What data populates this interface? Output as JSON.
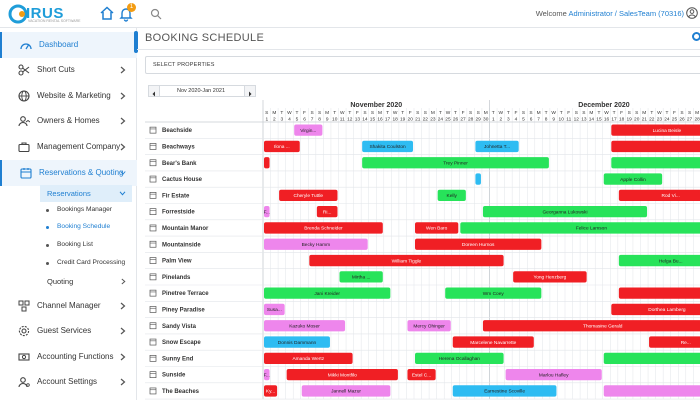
{
  "header": {
    "logo_text": "IRUS",
    "logo_tagline": "VACATION RENTAL SOFTWARE",
    "notification_count": "1",
    "welcome_prefix": "Welcome",
    "welcome_user": "Administrator / SalesTeam (70316)"
  },
  "sidebar": {
    "items": [
      {
        "label": "Dashboard",
        "icon": "dashboard-icon"
      },
      {
        "label": "Short Cuts",
        "icon": "scissors-icon"
      },
      {
        "label": "Website & Marketing",
        "icon": "globe-icon"
      },
      {
        "label": "Owners & Homes",
        "icon": "user-home-icon"
      },
      {
        "label": "Management Company",
        "icon": "briefcase-icon"
      },
      {
        "label": "Reservations & Quoting",
        "icon": "calendar-icon"
      },
      {
        "label": "Channel Manager",
        "icon": "channel-icon"
      },
      {
        "label": "Guest Services",
        "icon": "gear-icon"
      },
      {
        "label": "Accounting Functions",
        "icon": "money-icon"
      },
      {
        "label": "Account Settings",
        "icon": "user-settings-icon"
      }
    ],
    "submenu_head": "Reservations",
    "submenu": [
      "Bookings Manager",
      "Booking Schedule",
      "Booking List",
      "Credit Card Processing"
    ],
    "quoting": "Quoting"
  },
  "main": {
    "title": "BOOKING SCHEDULE",
    "select_properties": "SELECT PROPERTIES",
    "date_range": "Nov 2020-Jan 2021"
  },
  "colors": {
    "red": "#f01f24",
    "green": "#27e35a",
    "blue": "#2ebcf2",
    "pink": "#ee86ec",
    "accent": "#1f7fd1"
  },
  "schedule": {
    "months": [
      "November 2020",
      "December 2020"
    ],
    "day_letters": [
      "S",
      "M",
      "T",
      "W",
      "T",
      "F",
      "S"
    ],
    "properties": [
      "Beachside",
      "Beachways",
      "Bear's Bank",
      "Cactus House",
      "Fir Estate",
      "Forrestside",
      "Mountain Manor",
      "Mountainside",
      "Palm View",
      "Pinelands",
      "Pinetree Terrace",
      "Piney Paradise",
      "Sandy Vista",
      "Snow Escape",
      "Sunny End",
      "Sunside",
      "The Beaches"
    ],
    "bookings": [
      {
        "row": 0,
        "start": "2020-11-05",
        "end": "2020-11-08",
        "color": "pink",
        "label": "Virgin..."
      },
      {
        "row": 0,
        "start": "2020-12-17",
        "end": "2020-12-31",
        "color": "red",
        "label": "Lucina Beisle"
      },
      {
        "row": 1,
        "start": "2020-11-01",
        "end": "2020-11-05",
        "color": "red",
        "label": "Ilona ..."
      },
      {
        "row": 1,
        "start": "2020-11-14",
        "end": "2020-11-20",
        "color": "blue",
        "label": "Shakita Coulston"
      },
      {
        "row": 1,
        "start": "2020-11-29",
        "end": "2020-12-04",
        "color": "blue",
        "label": "Johnetta T..."
      },
      {
        "row": 1,
        "start": "2020-12-17",
        "end": "2020-12-31",
        "color": "red",
        "label": ""
      },
      {
        "row": 2,
        "start": "2020-11-01",
        "end": "2020-11-01",
        "color": "red",
        "label": ""
      },
      {
        "row": 2,
        "start": "2020-11-14",
        "end": "2020-12-08",
        "color": "green",
        "label": "Trey Pinner"
      },
      {
        "row": 2,
        "start": "2020-12-17",
        "end": "2020-12-31",
        "color": "green",
        "label": ""
      },
      {
        "row": 3,
        "start": "2020-11-29",
        "end": "2020-11-29",
        "color": "blue",
        "label": ""
      },
      {
        "row": 3,
        "start": "2020-12-16",
        "end": "2020-12-23",
        "color": "green",
        "label": "Apple Collin"
      },
      {
        "row": 4,
        "start": "2020-11-03",
        "end": "2020-11-10",
        "color": "red",
        "label": "Cheryle Tuttle"
      },
      {
        "row": 4,
        "start": "2020-11-24",
        "end": "2020-11-27",
        "color": "green",
        "label": "Kelly"
      },
      {
        "row": 4,
        "start": "2020-12-18",
        "end": "2020-12-31",
        "color": "red",
        "label": "Rod Vi..."
      },
      {
        "row": 5,
        "start": "2020-11-01",
        "end": "2020-11-01",
        "color": "pink",
        "label": "F..."
      },
      {
        "row": 5,
        "start": "2020-11-08",
        "end": "2020-11-10",
        "color": "red",
        "label": "Ri..."
      },
      {
        "row": 5,
        "start": "2020-11-30",
        "end": "2020-12-21",
        "color": "green",
        "label": "Georganna Lukowski"
      },
      {
        "row": 6,
        "start": "2020-11-01",
        "end": "2020-11-16",
        "color": "red",
        "label": "Brenda Schneider"
      },
      {
        "row": 6,
        "start": "2020-11-21",
        "end": "2020-11-26",
        "color": "red",
        "label": "Wen Baro"
      },
      {
        "row": 6,
        "start": "2020-11-27",
        "end": "2020-12-31",
        "color": "green",
        "label": "Felice Lamson"
      },
      {
        "row": 7,
        "start": "2020-11-01",
        "end": "2020-11-14",
        "color": "pink",
        "label": "Becky Hamm"
      },
      {
        "row": 7,
        "start": "2020-11-21",
        "end": "2020-12-07",
        "color": "red",
        "label": "Doreen Hurnos"
      },
      {
        "row": 8,
        "start": "2020-11-07",
        "end": "2020-12-02",
        "color": "red",
        "label": "William Tiggle"
      },
      {
        "row": 8,
        "start": "2020-12-18",
        "end": "2020-12-31",
        "color": "green",
        "label": "Helga Bu..."
      },
      {
        "row": 9,
        "start": "2020-11-11",
        "end": "2020-11-16",
        "color": "green",
        "label": "Mirtha ..."
      },
      {
        "row": 9,
        "start": "2020-12-04",
        "end": "2020-12-13",
        "color": "red",
        "label": "Yong Henzberg"
      },
      {
        "row": 10,
        "start": "2020-11-01",
        "end": "2020-11-17",
        "color": "green",
        "label": "Jani Kreider"
      },
      {
        "row": 10,
        "start": "2020-11-25",
        "end": "2020-12-07",
        "color": "green",
        "label": "Wm Coey"
      },
      {
        "row": 10,
        "start": "2020-12-18",
        "end": "2020-12-31",
        "color": "red",
        "label": ""
      },
      {
        "row": 11,
        "start": "2020-11-01",
        "end": "2020-11-03",
        "color": "pink",
        "label": "Susa..."
      },
      {
        "row": 11,
        "start": "2020-12-17",
        "end": "2020-12-31",
        "color": "red",
        "label": "Dorthea Lamberg"
      },
      {
        "row": 12,
        "start": "2020-11-01",
        "end": "2020-11-11",
        "color": "pink",
        "label": "Kazuko Moser"
      },
      {
        "row": 12,
        "start": "2020-11-20",
        "end": "2020-11-25",
        "color": "pink",
        "label": "Mercy Ohinger"
      },
      {
        "row": 12,
        "start": "2020-11-30",
        "end": "2020-12-31",
        "color": "red",
        "label": "Thomasine Gerald"
      },
      {
        "row": 13,
        "start": "2020-11-01",
        "end": "2020-11-09",
        "color": "blue",
        "label": "Donnis Dammann"
      },
      {
        "row": 13,
        "start": "2020-11-26",
        "end": "2020-12-06",
        "color": "red",
        "label": "Marcelene Navarrette"
      },
      {
        "row": 13,
        "start": "2020-12-22",
        "end": "2020-12-31",
        "color": "red",
        "label": "Re..."
      },
      {
        "row": 14,
        "start": "2020-11-01",
        "end": "2020-11-12",
        "color": "red",
        "label": "Amanda Wertz"
      },
      {
        "row": 14,
        "start": "2020-11-21",
        "end": "2020-12-02",
        "color": "green",
        "label": "Herena Ocallaghan"
      },
      {
        "row": 14,
        "start": "2020-12-16",
        "end": "2020-12-31",
        "color": "green",
        "label": ""
      },
      {
        "row": 15,
        "start": "2020-11-01",
        "end": "2020-11-01",
        "color": "pink",
        "label": "F..."
      },
      {
        "row": 15,
        "start": "2020-11-04",
        "end": "2020-11-18",
        "color": "red",
        "label": "Mikki Montfilo"
      },
      {
        "row": 15,
        "start": "2020-11-20",
        "end": "2020-11-23",
        "color": "red",
        "label": "Estel C..."
      },
      {
        "row": 15,
        "start": "2020-12-03",
        "end": "2020-12-15",
        "color": "pink",
        "label": "Marlou Hafley"
      },
      {
        "row": 16,
        "start": "2020-11-01",
        "end": "2020-11-02",
        "color": "red",
        "label": "Ky..."
      },
      {
        "row": 16,
        "start": "2020-11-06",
        "end": "2020-11-17",
        "color": "pink",
        "label": "Jannell Mazur"
      },
      {
        "row": 16,
        "start": "2020-11-26",
        "end": "2020-12-09",
        "color": "blue",
        "label": "Earnestine Scoville"
      },
      {
        "row": 16,
        "start": "2020-12-16",
        "end": "2020-12-31",
        "color": "pink",
        "label": ""
      }
    ]
  }
}
